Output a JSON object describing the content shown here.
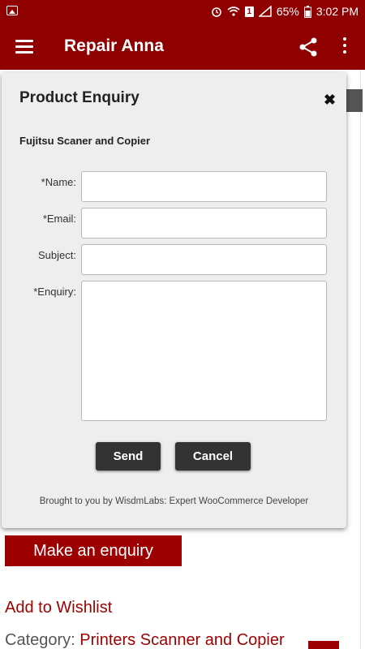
{
  "status_bar": {
    "battery": "65%",
    "time": "3:02 PM",
    "icons": [
      "image-icon",
      "alarm-icon",
      "wifi-icon",
      "notification-badge-icon",
      "signal-icon",
      "battery-icon"
    ],
    "notification_count": "1"
  },
  "app_bar": {
    "title": "Repair Anna",
    "icons": [
      "menu-icon",
      "share-icon",
      "more-vert-icon"
    ]
  },
  "dialog": {
    "title": "Product Enquiry",
    "close_label": "✖",
    "product_name": "Fujitsu Scaner and Copier",
    "fields": {
      "name_label": "*Name:",
      "email_label": "*Email:",
      "subject_label": "Subject:",
      "enquiry_label": "*Enquiry:",
      "name_value": "",
      "email_value": "",
      "subject_value": "",
      "enquiry_value": ""
    },
    "send_label": "Send",
    "cancel_label": "Cancel",
    "credit": "Brought to you by WisdmLabs: Expert WooCommerce Developer"
  },
  "page": {
    "enquiry_button": "Make an enquiry",
    "wishlist_link": "Add to Wishlist",
    "category_prefix": "Category: ",
    "category_link": "Printers Scanner and Copier"
  },
  "colors": {
    "brand": "#8f0000",
    "accent": "#9c0000",
    "dialog_bg": "#eeeeee",
    "button_dark": "#333333"
  }
}
